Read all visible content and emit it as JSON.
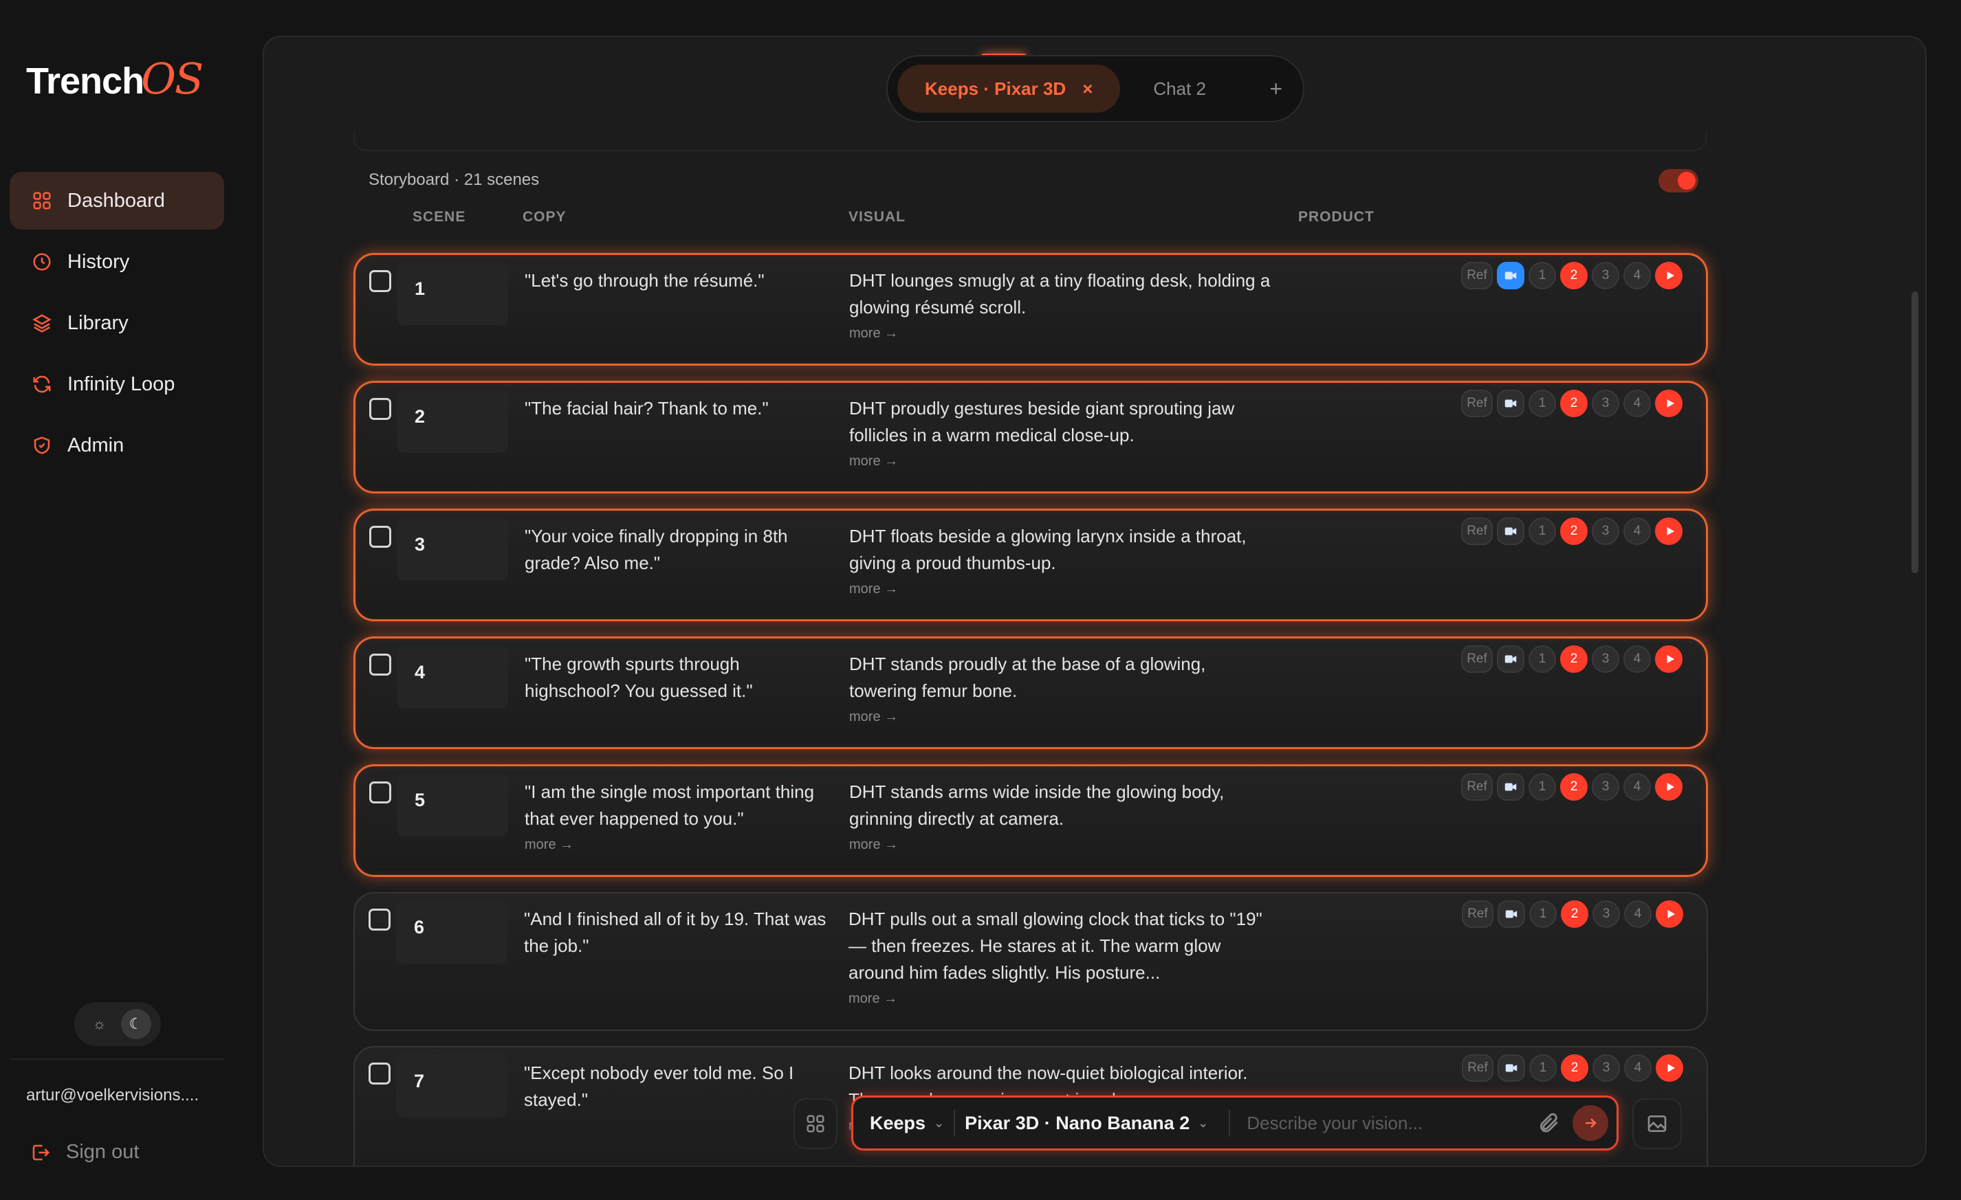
{
  "app": {
    "logo_main": "Trench",
    "logo_accent": "OS"
  },
  "sidebar": {
    "items": [
      {
        "label": "Dashboard",
        "icon": "dashboard-icon",
        "active": true
      },
      {
        "label": "History",
        "icon": "clock-icon"
      },
      {
        "label": "Library",
        "icon": "layers-icon"
      },
      {
        "label": "Infinity Loop",
        "icon": "refresh-icon"
      },
      {
        "label": "Admin",
        "icon": "shield-icon"
      }
    ],
    "theme": {
      "light_icon": "sun-icon",
      "dark_icon": "moon-icon",
      "selected": "dark"
    },
    "user_email": "artur@voelkervisions....",
    "signout_label": "Sign out"
  },
  "tabs": {
    "active_label": "Keeps · Pixar 3D",
    "active_close": "×",
    "inactive_label": "Chat 2",
    "add_label": "+"
  },
  "storyboard": {
    "title": "Storyboard · 21 scenes",
    "toggle_on": true,
    "columns": {
      "scene": "SCENE",
      "copy": "COPY",
      "visual": "VISUAL",
      "product": "PRODUCT"
    },
    "more_label": "more →",
    "ref_label": "Ref",
    "variant_labels": [
      "1",
      "2",
      "3",
      "4"
    ],
    "selected_variant": "2",
    "rows": [
      {
        "num": "1",
        "copy": "\"Let's go through the résumé.\"",
        "visual": "DHT lounges smugly at a tiny floating desk, holding a glowing résumé scroll.",
        "copy_more": false
      },
      {
        "num": "2",
        "copy": "\"The facial hair? Thank to me.\"",
        "visual": "DHT proudly gestures beside giant sprouting jaw follicles in a warm medical close-up.",
        "copy_more": false
      },
      {
        "num": "3",
        "copy": "\"Your voice finally dropping in 8th grade? Also me.\"",
        "visual": "DHT floats beside a glowing larynx inside a throat, giving a proud thumbs-up.",
        "copy_more": false
      },
      {
        "num": "4",
        "copy": "\"The growth spurts through highschool? You guessed it.\"",
        "visual": "DHT stands proudly at the base of a glowing, towering femur bone.",
        "copy_more": false
      },
      {
        "num": "5",
        "copy": "\"I am the single most important thing that ever happened to you.\"",
        "visual": "DHT stands arms wide inside the glowing body, grinning directly at camera.",
        "copy_more": true
      },
      {
        "num": "6",
        "copy": "\"And I finished all of it by 19. That was the job.\"",
        "visual": "DHT pulls out a small glowing clock that ticks to \"19\" — then freezes. He stares at it. The warm glow around him fades slightly. His posture...",
        "copy_more": false
      },
      {
        "num": "7",
        "copy": "\"Except nobody ever told me. So I stayed.\"",
        "visual": "DHT looks around the now-quiet biological interior. The once-busy environment is calm...",
        "copy_more": false
      }
    ]
  },
  "composer": {
    "mode_label": "Keeps",
    "model_label": "Pixar 3D · Nano Banana 2",
    "placeholder": "Describe your vision...",
    "value": ""
  },
  "colors": {
    "accent": "#ff5b3a",
    "highlight": "#e8632f",
    "play": "#ff3b2a",
    "blue": "#2b8cff"
  }
}
